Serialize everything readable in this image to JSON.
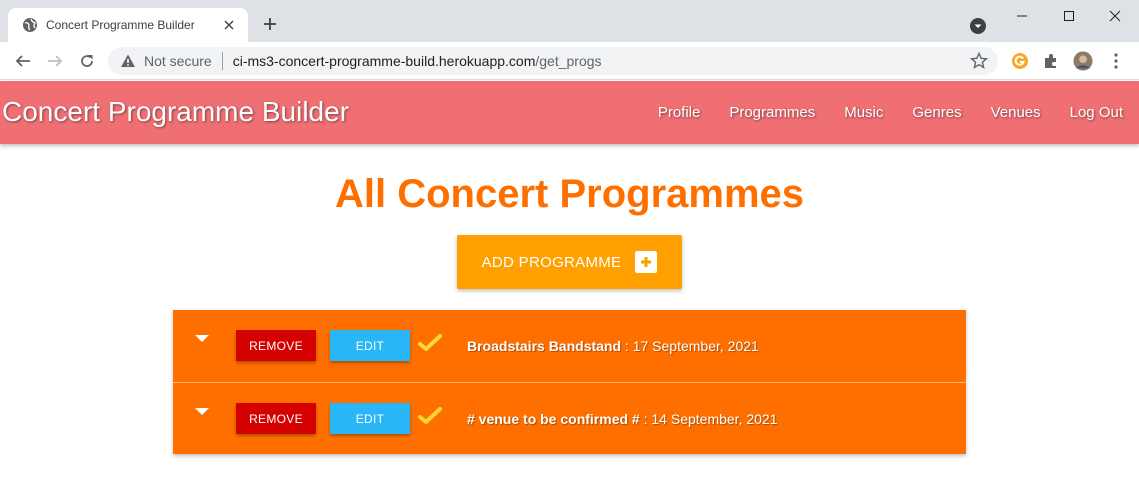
{
  "browser": {
    "tab_title": "Concert Programme Builder",
    "security_label": "Not secure",
    "url_host": "ci-ms3-concert-programme-build.herokuapp.com",
    "url_path": "/get_progs"
  },
  "site": {
    "brand": "Concert Programme Builder",
    "nav": [
      "Profile",
      "Programmes",
      "Music",
      "Genres",
      "Venues",
      "Log Out"
    ],
    "nav_color": "#ef6f73"
  },
  "main": {
    "title": "All Concert Programmes",
    "add_button_label": "ADD PROGRAMME",
    "accent_color": "#ff6f00"
  },
  "programmes": [
    {
      "venue": "Broadstairs Bandstand",
      "separator": " : ",
      "date": "17 September, 2021",
      "remove_label": "REMOVE",
      "edit_label": "EDIT"
    },
    {
      "venue": "# venue to be confirmed #",
      "separator": " : ",
      "date": "14 September, 2021",
      "remove_label": "REMOVE",
      "edit_label": "EDIT"
    }
  ]
}
